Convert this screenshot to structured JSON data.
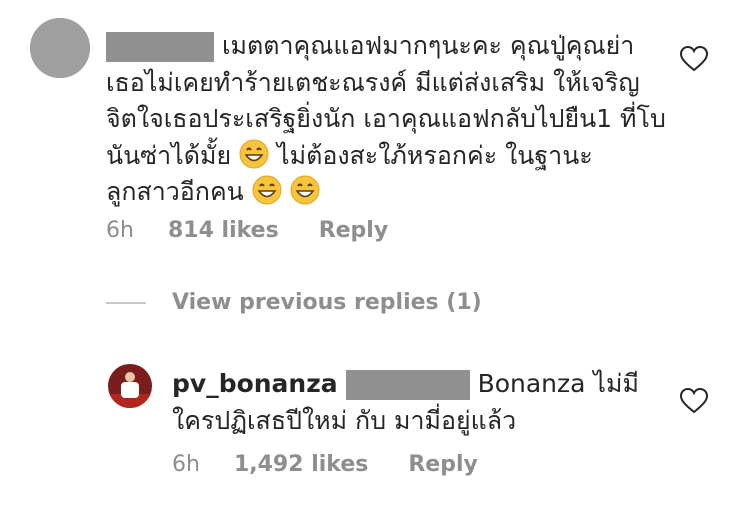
{
  "comment": {
    "text_before": "เมตตาคุณแอฟมากๆนะคะ คุณปู่คุณย่า เธอไม่เคยทำร้ายเตชะณรงค์ มีแต่ส่งเสริม ให้เจริญ จิตใจเธอประเสริฐยิ่งนัก เอาคุณแอฟกลับไปยืน1 ที่โบนันซ่าได้มั้ย",
    "text_middle": " ไม่ต้องสะใภ้หรอกค่ะ ในฐานะลูกสาวอีกคน",
    "time": "6h",
    "likes": "814 likes",
    "reply": "Reply"
  },
  "view_previous_replies": "View previous replies (1)",
  "reply_comment": {
    "username": "pv_bonanza",
    "text": "Bonanza ไม่มีใครปฏิเสธปีใหม่ กับ มามี่อยู่แล้ว",
    "time": "6h",
    "likes": "1,492 likes",
    "reply": "Reply"
  },
  "icons": {
    "like": "heart-outline-icon",
    "emoji": "grinning-face-emoji"
  },
  "colors": {
    "text": "#262626",
    "secondary": "#8e8e8e",
    "redaction": "#909090"
  }
}
